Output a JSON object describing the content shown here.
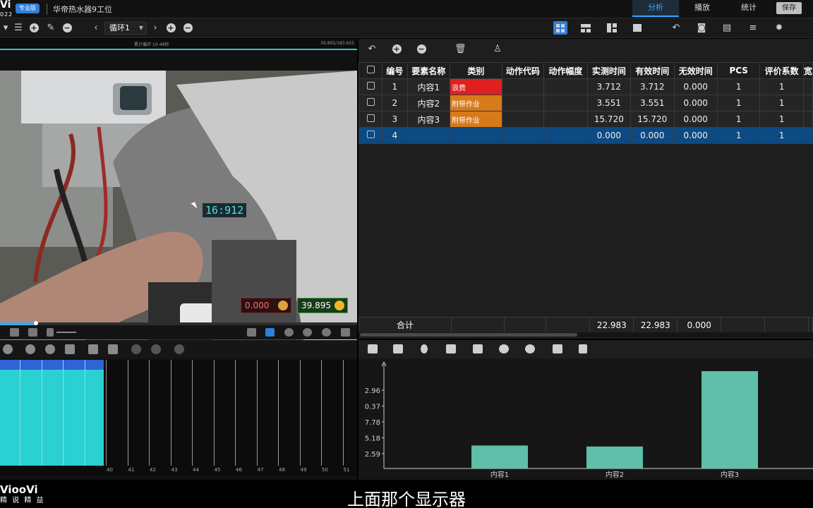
{
  "titlebar": {
    "brand_main": "Vi",
    "brand_year": "022",
    "edition": "专业版",
    "project_title": "华帝热水器9工位",
    "tabs": [
      {
        "label": "分析",
        "active": true
      },
      {
        "label": "播放",
        "active": false
      },
      {
        "label": "统计",
        "active": false
      }
    ],
    "save_label": "保存"
  },
  "toolbar": {
    "loop_select": "循环1"
  },
  "video": {
    "top_center_text": "累计循环 10-48秒",
    "top_right_text": "39.895/183.655",
    "timestamp": "16:912",
    "invalid_time": "0.000",
    "valid_time": "39.895",
    "progress": 0.1
  },
  "table": {
    "columns": [
      "",
      "编号",
      "要素名称",
      "类别",
      "动作代码",
      "动作幅度",
      "实测时间",
      "有效时间",
      "无效时间",
      "PCS",
      "评价系数",
      "宽"
    ],
    "rows": [
      {
        "no": "1",
        "name": "内容1",
        "category": "浪费",
        "category_color": "#e02020",
        "code": "",
        "range": "",
        "measured": "3.712",
        "effective": "3.712",
        "invalid": "0.000",
        "pcs": "1",
        "factor": "1",
        "selected": false
      },
      {
        "no": "2",
        "name": "内容2",
        "category": "附带作业",
        "category_color": "#d77a1a",
        "code": "",
        "range": "",
        "measured": "3.551",
        "effective": "3.551",
        "invalid": "0.000",
        "pcs": "1",
        "factor": "1",
        "selected": false
      },
      {
        "no": "3",
        "name": "内容3",
        "category": "附带作业",
        "category_color": "#d77a1a",
        "code": "",
        "range": "",
        "measured": "15.720",
        "effective": "15.720",
        "invalid": "0.000",
        "pcs": "1",
        "factor": "1",
        "selected": false
      },
      {
        "no": "4",
        "name": "",
        "category": "",
        "category_color": "",
        "code": "",
        "range": "",
        "measured": "0.000",
        "effective": "0.000",
        "invalid": "0.000",
        "pcs": "1",
        "factor": "1",
        "selected": true
      }
    ],
    "footer": {
      "label": "合计",
      "measured": "22.983",
      "effective": "22.983",
      "invalid": "0.000"
    }
  },
  "timeline": {
    "ticks": [
      "40",
      "41",
      "42",
      "43",
      "44",
      "45",
      "46",
      "47",
      "48",
      "49",
      "50",
      "51"
    ],
    "progress": 0.29
  },
  "chart_data": {
    "type": "bar",
    "categories": [
      "内容1",
      "内容2",
      "内容3"
    ],
    "values": [
      3.712,
      3.551,
      15.72
    ],
    "yticks": [
      "2.59",
      "5.18",
      "7.78",
      "0.37",
      "2.96"
    ],
    "ylim": [
      0,
      15.72
    ],
    "bar_color": "#5fbfa8",
    "xlabel": "",
    "ylabel": "",
    "title": ""
  },
  "watermark": {
    "main": "ViooVi",
    "sub": "精 说 精 益"
  },
  "subtitle": "上面那个显示器"
}
